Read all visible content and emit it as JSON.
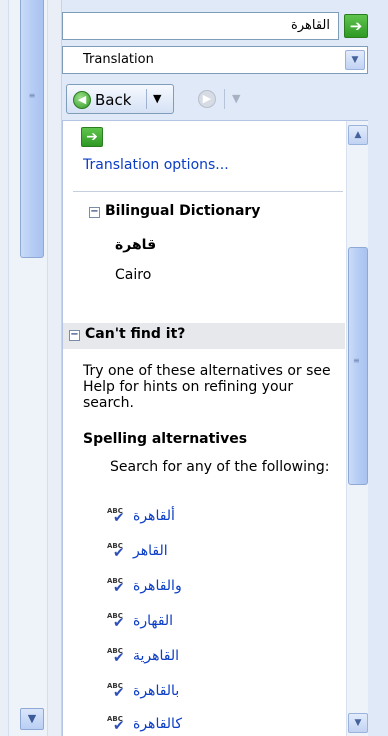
{
  "search": {
    "value": "القاهرة",
    "go_icon": "green-right-arrow"
  },
  "service": {
    "selected": "Translation"
  },
  "nav": {
    "back_label": "Back"
  },
  "results": {
    "translation_options_label": "Translation options...",
    "bilingual_title": "Bilingual Dictionary",
    "arabic_term": "قاهرة",
    "english_term": "Cairo",
    "cantfind_title": "Can't find it?",
    "cantfind_text": "Try one of these alternatives or see Help for hints on refining your search.",
    "spelling_title": "Spelling alternatives",
    "search_for_text": "Search for any of the following:",
    "alternatives": [
      "ألقاهرة",
      "القاهر",
      "والقاهرة",
      "القهارة",
      "القاهرية",
      "بالقاهرة",
      "كالقاهرة"
    ]
  }
}
